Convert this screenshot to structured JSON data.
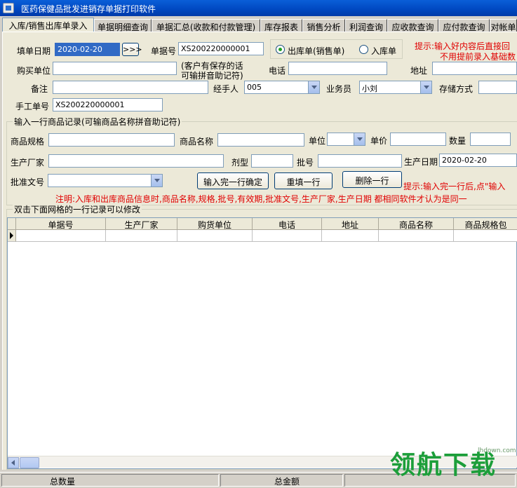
{
  "window": {
    "title": "医药保健品批发进销存单据打印软件"
  },
  "tabs": [
    {
      "label": "入库/销售出库单录入",
      "active": true
    },
    {
      "label": "单据明细查询"
    },
    {
      "label": "单据汇总(收款和付款管理)"
    },
    {
      "label": "库存报表"
    },
    {
      "label": "销售分析"
    },
    {
      "label": "利润查询"
    },
    {
      "label": "应收款查询"
    },
    {
      "label": "应付款查询"
    },
    {
      "label": "对帐单"
    }
  ],
  "header_form": {
    "fill_date_label": "填单日期",
    "fill_date_value": "2020-02-20",
    "date_picker_button": ">>>",
    "doc_no_label": "单据号",
    "doc_no_value": "XS200220000001",
    "radio_out_label": "出库单(销售单)",
    "radio_in_label": "入库单",
    "tip_line1": "提示:输入好内容后直接回",
    "tip_line2": "不用提前录入基础数",
    "buyer_label": "购买单位",
    "buyer_value": "",
    "buyer_hint_line1": "(客户有保存的话",
    "buyer_hint_line2": "可输拼音助记符)",
    "phone_label": "电话",
    "phone_value": "",
    "address_label": "地址",
    "address_value": "",
    "remark_label": "备注",
    "remark_value": "",
    "handler_label": "经手人",
    "handler_value": "005",
    "salesman_label": "业务员",
    "salesman_value": "小刘",
    "storage_label": "存储方式",
    "storage_value": "",
    "manual_no_label": "手工单号",
    "manual_no_value": "XS200220000001"
  },
  "item_form": {
    "group_title": "输入一行商品记录(可输商品名称拼音助记符)",
    "spec_label": "商品规格",
    "spec_value": "",
    "name_label": "商品名称",
    "name_value": "",
    "unit_label": "单位",
    "unit_value": "",
    "price_label": "单价",
    "price_value": "",
    "qty_label": "数量",
    "qty_value": "",
    "maker_label": "生产厂家",
    "maker_value": "",
    "form_label": "剂型",
    "form_value": "",
    "batch_label": "批号",
    "batch_value": "",
    "mfg_date_label": "生产日期",
    "mfg_date_value": "2020-02-20",
    "approval_label": "批准文号",
    "approval_value": "",
    "confirm_button": "输入完一行确定",
    "refill_button": "重填一行",
    "delete_button": "删除一行",
    "tip_row": "提示:输入完一行后,点\"输入",
    "note": "注明:入库和出库商品信息时,商品名称,规格,批号,有效期,批准文号,生产厂家,生产日期 都相同软件才认为是同一"
  },
  "grid": {
    "group_title": "双击下面网格的一行记录可以修改",
    "columns": [
      "单据号",
      "生产厂家",
      "购货单位",
      "电话",
      "地址",
      "商品名称",
      "商品规格包"
    ]
  },
  "status": {
    "total_qty_label": "总数量",
    "total_amount_label": "总金额"
  },
  "watermark": {
    "text": "领航下载",
    "url": "lhdown.com"
  },
  "colors": {
    "title_blue": "#0047c0",
    "tip_red": "#e00000",
    "selection": "#316ac5"
  }
}
